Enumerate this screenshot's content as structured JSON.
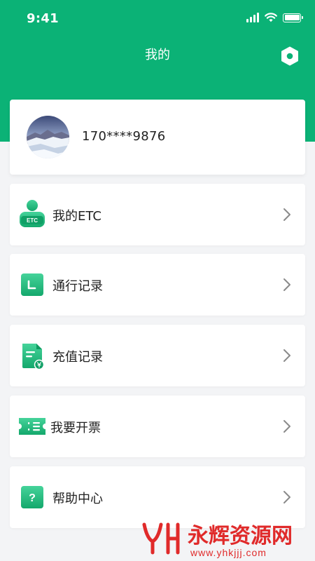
{
  "status_bar": {
    "time": "9:41"
  },
  "nav": {
    "title": "我的",
    "settings_icon": "settings-hex-icon"
  },
  "profile": {
    "phone": "170****9876",
    "avatar_icon": "avatar-photo"
  },
  "menu": [
    {
      "label": "我的ETC",
      "icon": "etc-user-icon",
      "badge": "ETC"
    },
    {
      "label": "通行记录",
      "icon": "pass-record-icon"
    },
    {
      "label": "充值记录",
      "icon": "recharge-record-icon"
    },
    {
      "label": "我要开票",
      "icon": "ticket-icon"
    },
    {
      "label": "帮助中心",
      "icon": "help-icon",
      "glyph": "?"
    }
  ],
  "watermark": {
    "text": "永辉资源网",
    "url": "www.yhkjjj.com"
  },
  "colors": {
    "brand_green": "#0bb276",
    "background": "#f3f4f6",
    "card": "#ffffff",
    "chevron": "#8a8a8a",
    "watermark_red": "#e02a2a"
  }
}
